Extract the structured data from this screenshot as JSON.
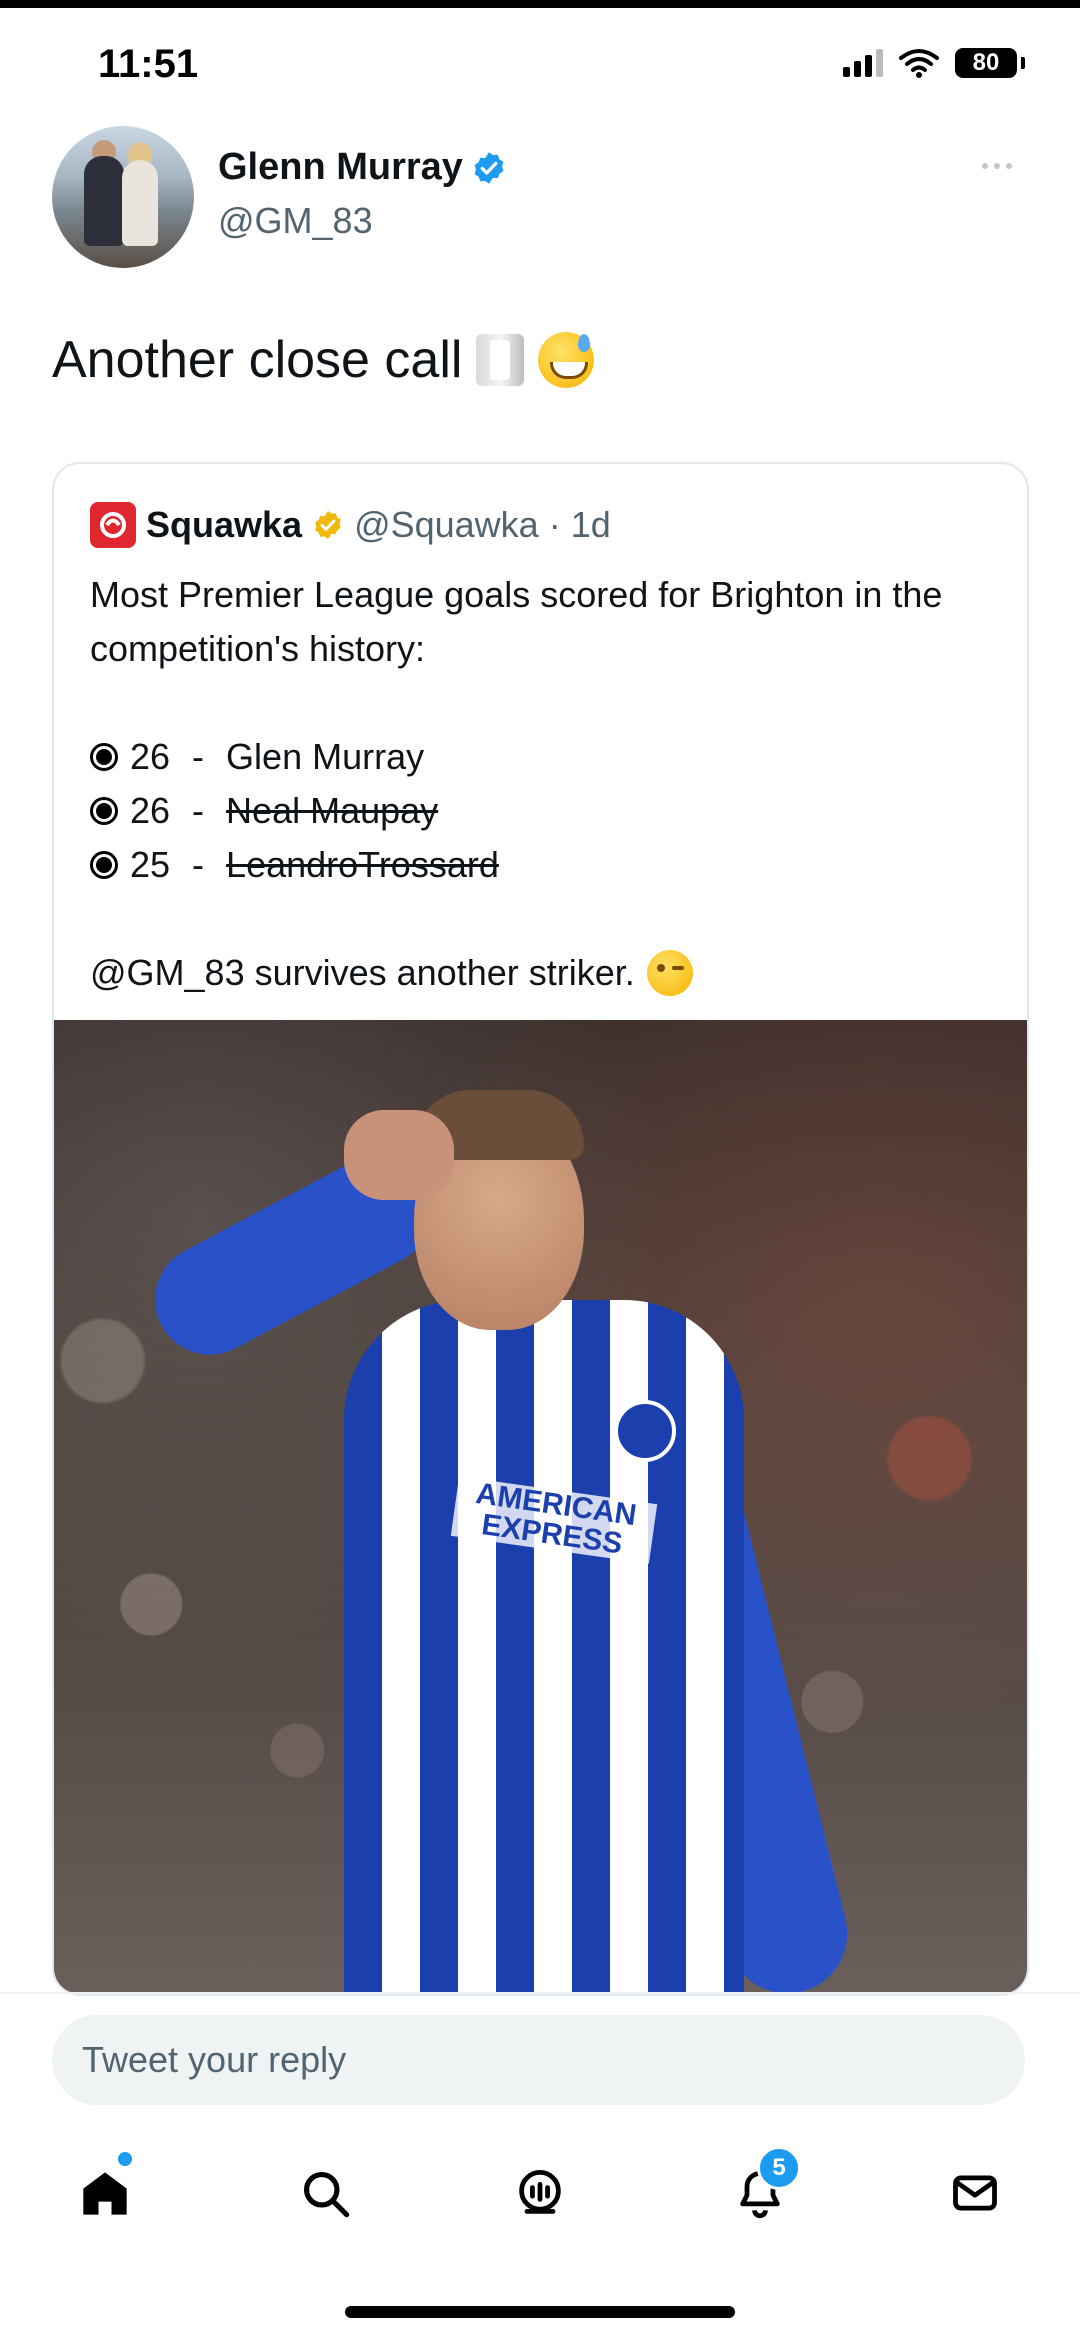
{
  "status_bar": {
    "time": "11:51",
    "battery": "80"
  },
  "tweet": {
    "author_name": "Glenn Murray",
    "author_handle": "@GM_83",
    "text": "Another close call",
    "emojis": [
      "toilet-paper-emoji",
      "sweat-smile-emoji"
    ]
  },
  "quote": {
    "source_name": "Squawka",
    "source_handle": "@Squawka",
    "time": "· 1d",
    "line1": "Most Premier League goals scored for Brighton in the competition's history:",
    "items": [
      {
        "count": "26",
        "sep": " - ",
        "name": "Glen Murray"
      },
      {
        "count": "26",
        "sep": " - ",
        "name": "Neal Maupay"
      },
      {
        "count": "25",
        "sep": " - ",
        "name": "LeandroTrossard"
      }
    ],
    "outro": "@GM_83 survives another striker.",
    "photo_sponsor": "AMERICAN EXPRESS"
  },
  "reply": {
    "placeholder": "Tweet your reply"
  },
  "nav": {
    "notifications_badge": "5"
  },
  "colors": {
    "accent": "#1d9bf0",
    "verified_gold": "#f0b90b",
    "squawka_red": "#e0262f"
  }
}
